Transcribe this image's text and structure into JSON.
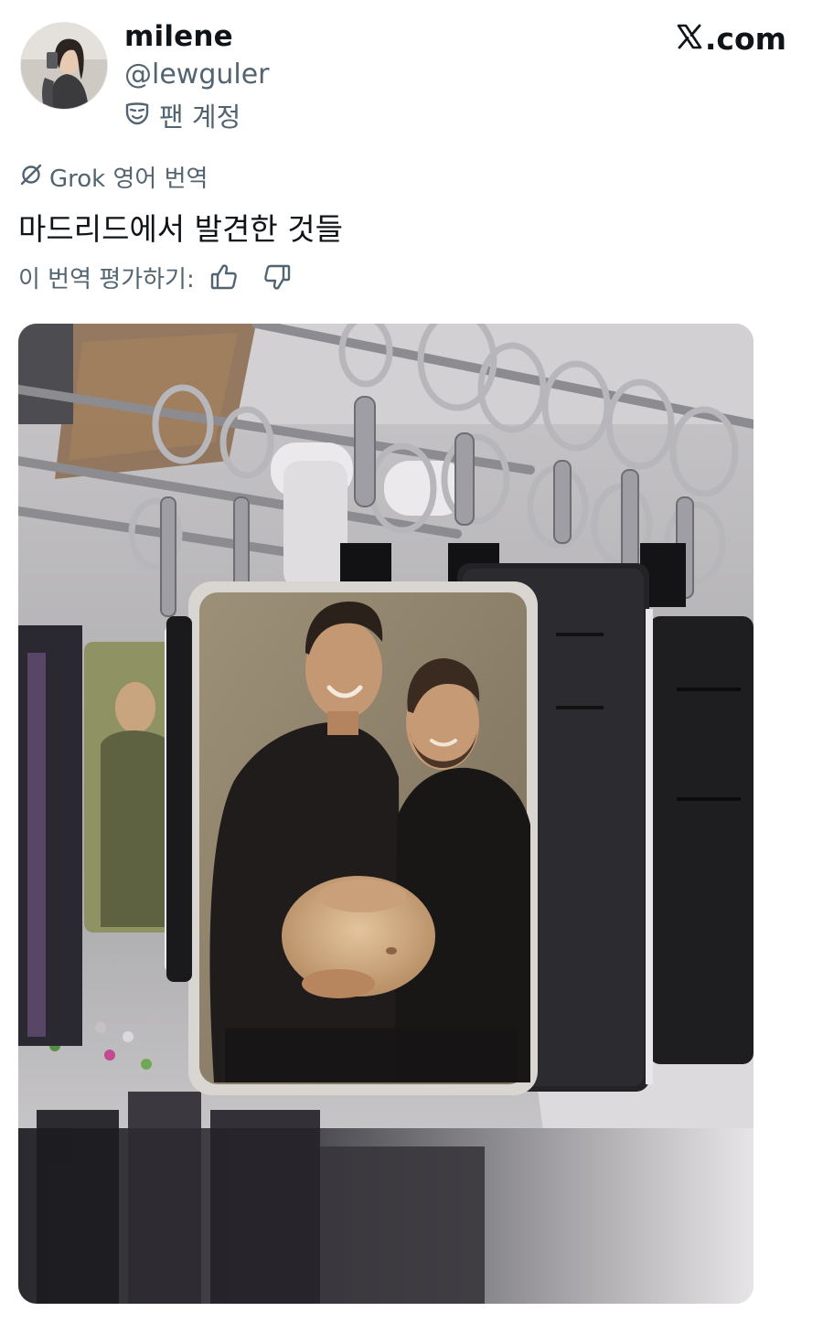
{
  "user": {
    "display_name": "milene",
    "handle": "@lewguler",
    "account_label": "팬 계정",
    "account_icon": "mask-icon"
  },
  "brand": {
    "logo_icon": "x-logo-icon",
    "site": ".com"
  },
  "translation": {
    "label": "Grok 영어 번역",
    "icon": "grok-icon"
  },
  "post": {
    "text": "마드리드에서 발견한 것들"
  },
  "rating": {
    "label": "이 번역 평가하기:",
    "thumbs_up_icon": "thumbs-up-icon",
    "thumbs_down_icon": "thumbs-down-icon"
  },
  "colors": {
    "text_primary": "#0f1419",
    "text_secondary": "#536471"
  }
}
